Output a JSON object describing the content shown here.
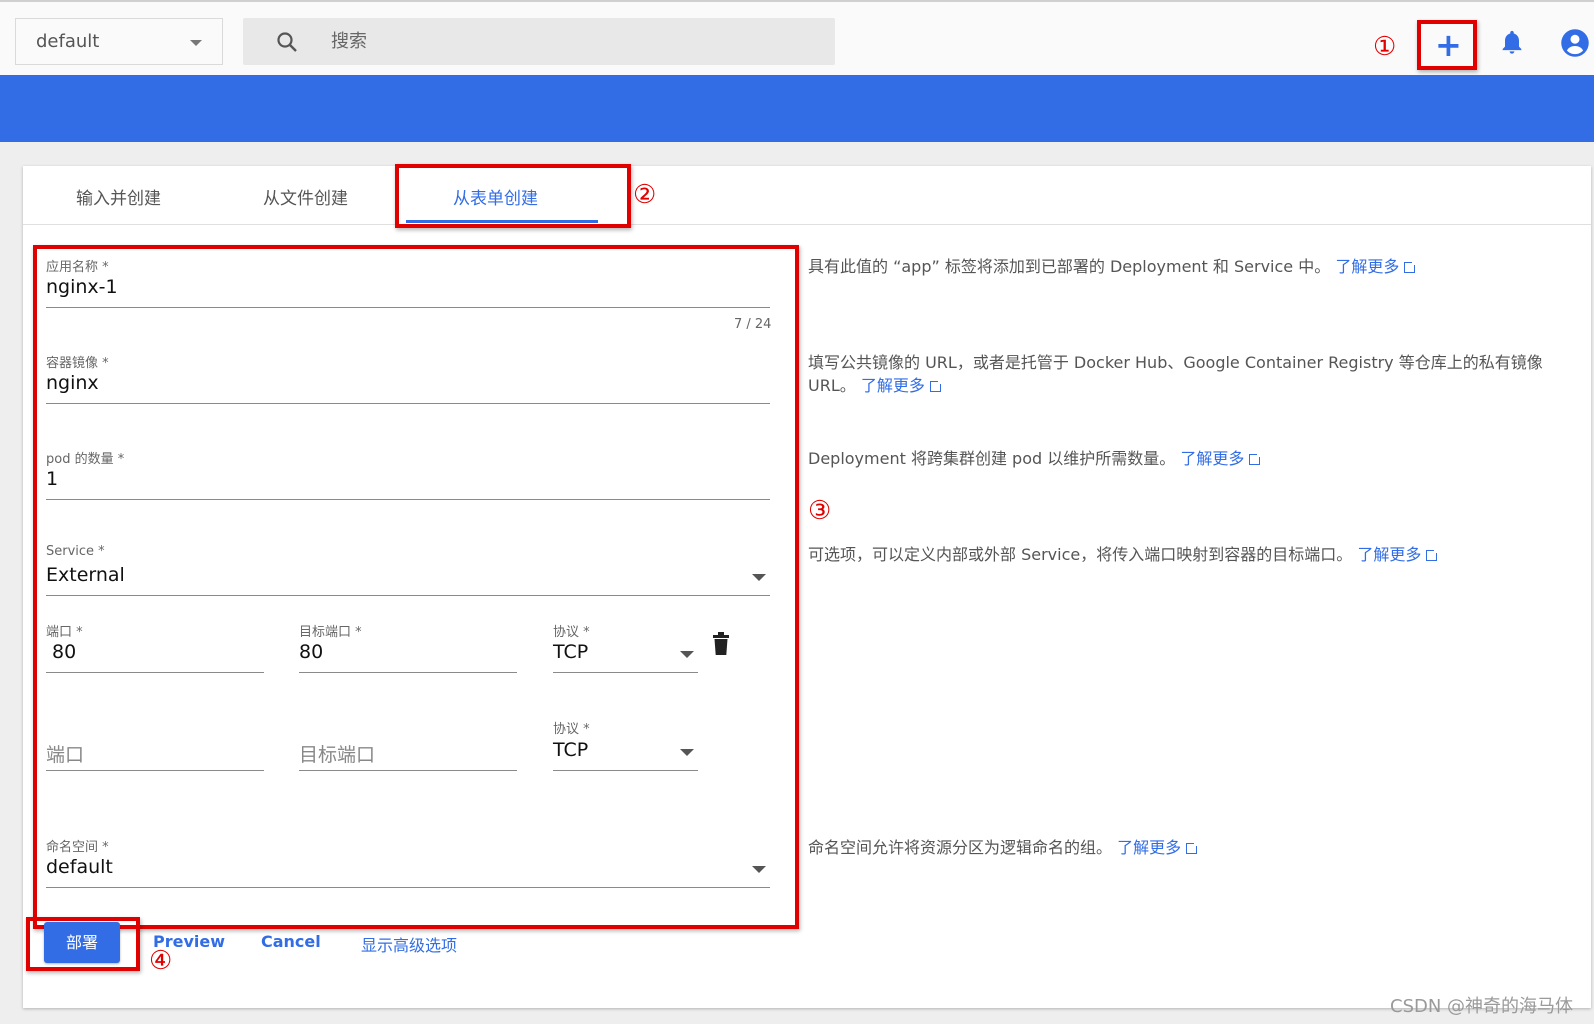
{
  "topbar": {
    "namespace_value": "default",
    "search_placeholder": "搜索",
    "create_label": "+",
    "annotation_1": "①"
  },
  "tabs": [
    {
      "label": "输入并创建"
    },
    {
      "label": "从文件创建"
    },
    {
      "label": "从表单创建",
      "active": true
    }
  ],
  "annotation_2": "②",
  "annotation_3": "③",
  "annotation_4": "④",
  "form": {
    "app_name": {
      "label": "应用名称 *",
      "value": "nginx-1",
      "counter": "7 / 24"
    },
    "image": {
      "label": "容器镜像 *",
      "value": "nginx"
    },
    "pods": {
      "label": "pod 的数量 *",
      "value": "1"
    },
    "service": {
      "label": "Service *",
      "value": "External"
    },
    "port_row_1": {
      "port_label": "端口 *",
      "port_value": "80",
      "target_label": "目标端口 *",
      "target_value": "80",
      "protocol_label": "协议 *",
      "protocol_value": "TCP"
    },
    "port_row_2": {
      "port_placeholder": "端口",
      "target_placeholder": "目标端口",
      "protocol_label": "协议 *",
      "protocol_value": "TCP"
    },
    "namespace": {
      "label": "命名空间 *",
      "value": "default"
    }
  },
  "help": {
    "app_name": "具有此值的 “app” 标签将添加到已部署的 Deployment 和 Service 中。",
    "image_1": "填写公共镜像的 URL，或者是托管于 Docker Hub、Google Container Registry 等仓库上的私有镜像",
    "image_2": "URL。",
    "pods": "Deployment 将跨集群创建 pod 以维护所需数量。",
    "service": "可选项，可以定义内部或外部 Service，将传入端口映射到容器的目标端口。",
    "namespace": "命名空间允许将资源分区为逻辑命名的组。",
    "learn_more": "了解更多"
  },
  "actions": {
    "deploy": "部署",
    "preview": "Preview",
    "cancel": "Cancel",
    "advanced": "显示高级选项"
  },
  "watermark": "CSDN @神奇的海马体",
  "colors": {
    "accent": "#326de6",
    "highlight": "#e00000"
  }
}
